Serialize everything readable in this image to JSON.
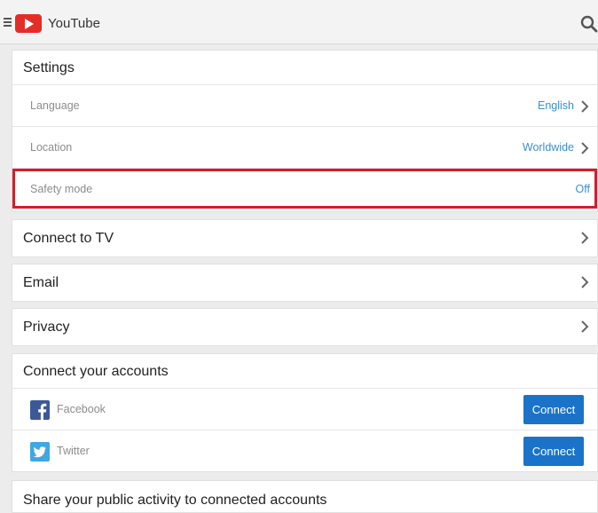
{
  "header": {
    "title": "YouTube"
  },
  "settings": {
    "title": "Settings",
    "rows": [
      {
        "label": "Language",
        "value": "English"
      },
      {
        "label": "Location",
        "value": "Worldwide"
      },
      {
        "label": "Safety mode",
        "value": "Off"
      }
    ]
  },
  "nav": {
    "connect_tv": "Connect to TV",
    "email": "Email",
    "privacy": "Privacy"
  },
  "accounts": {
    "title": "Connect your accounts",
    "items": [
      {
        "name": "Facebook",
        "button": "Connect"
      },
      {
        "name": "Twitter",
        "button": "Connect"
      }
    ]
  },
  "share": {
    "title": "Share your public activity to connected accounts"
  },
  "colors": {
    "brand": "#e52d27",
    "link": "#3a8fd0",
    "button": "#1a73c9",
    "highlight": "#d21f2a"
  },
  "icons": [
    "menu-icon",
    "youtube-logo-icon",
    "search-icon",
    "chevron-right-icon",
    "facebook-icon",
    "twitter-icon"
  ]
}
